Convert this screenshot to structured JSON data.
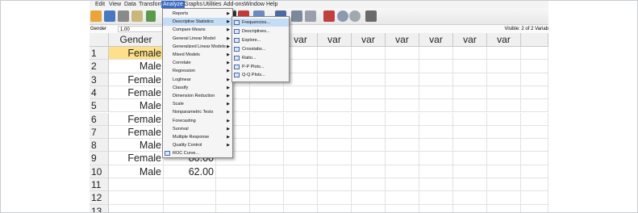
{
  "menubar": {
    "items": [
      "Edit",
      "View",
      "Data",
      "Transform",
      "Analyze",
      "Graphs",
      "Utilities",
      "Add-ons",
      "Window",
      "Help"
    ],
    "active": "Analyze"
  },
  "cellbar": {
    "name": "Gender",
    "value": "1.00",
    "visible": "Visible: 2 of 2 Variab"
  },
  "grid": {
    "headers": [
      "Gender",
      "",
      "var",
      "var",
      "var",
      "var",
      "var",
      "var",
      "var",
      "var",
      "var"
    ],
    "rows": [
      {
        "num": "1",
        "gender": "Female",
        "value": ""
      },
      {
        "num": "2",
        "gender": "Male",
        "value": ""
      },
      {
        "num": "3",
        "gender": "Female",
        "value": ""
      },
      {
        "num": "4",
        "gender": "Female",
        "value": ""
      },
      {
        "num": "5",
        "gender": "Male",
        "value": ""
      },
      {
        "num": "6",
        "gender": "Female",
        "value": ""
      },
      {
        "num": "7",
        "gender": "Female",
        "value": ""
      },
      {
        "num": "8",
        "gender": "Male",
        "value": ""
      },
      {
        "num": "9",
        "gender": "Female",
        "value": "80.00"
      },
      {
        "num": "10",
        "gender": "Male",
        "value": "62.00"
      },
      {
        "num": "11",
        "gender": "",
        "value": ""
      },
      {
        "num": "12",
        "gender": "",
        "value": ""
      },
      {
        "num": "13",
        "gender": "",
        "value": ""
      }
    ]
  },
  "analyze_menu": {
    "items": [
      {
        "label": "Reports",
        "submenu": true
      },
      {
        "label": "Descriptive Statistics",
        "submenu": true,
        "highlighted": true
      },
      {
        "label": "Compare Means",
        "submenu": true
      },
      {
        "label": "General Linear Model",
        "submenu": true
      },
      {
        "label": "Generalized Linear Models",
        "submenu": true
      },
      {
        "label": "Mixed Models",
        "submenu": true
      },
      {
        "label": "Correlate",
        "submenu": true
      },
      {
        "label": "Regression",
        "submenu": true
      },
      {
        "label": "Loglinear",
        "submenu": true
      },
      {
        "label": "Classify",
        "submenu": true
      },
      {
        "label": "Dimension Reduction",
        "submenu": true
      },
      {
        "label": "Scale",
        "submenu": true
      },
      {
        "label": "Nonparametric Tests",
        "submenu": true
      },
      {
        "label": "Forecasting",
        "submenu": true
      },
      {
        "label": "Survival",
        "submenu": true
      },
      {
        "label": "Multiple Response",
        "submenu": true
      },
      {
        "label": "Quality Control",
        "submenu": true
      },
      {
        "label": "ROC Curve...",
        "submenu": false,
        "icon": "roc-curve-icon"
      }
    ]
  },
  "descriptive_menu": {
    "items": [
      {
        "label": "Frequencies...",
        "icon": "frequencies-icon",
        "highlighted": true
      },
      {
        "label": "Descriptives...",
        "icon": "descriptives-icon"
      },
      {
        "label": "Explore...",
        "icon": "explore-icon"
      },
      {
        "label": "Crosstabs...",
        "icon": "crosstabs-icon"
      },
      {
        "label": "Ratio...",
        "icon": "ratio-icon"
      },
      {
        "label": "P-P Plots...",
        "icon": "pp-plots-icon"
      },
      {
        "label": "Q-Q Plots...",
        "icon": "qq-plots-icon"
      }
    ]
  },
  "colors": {
    "menu_active": "#3b6cc4",
    "highlight": "#c5dcf5",
    "selected_cell": "#fde089"
  }
}
